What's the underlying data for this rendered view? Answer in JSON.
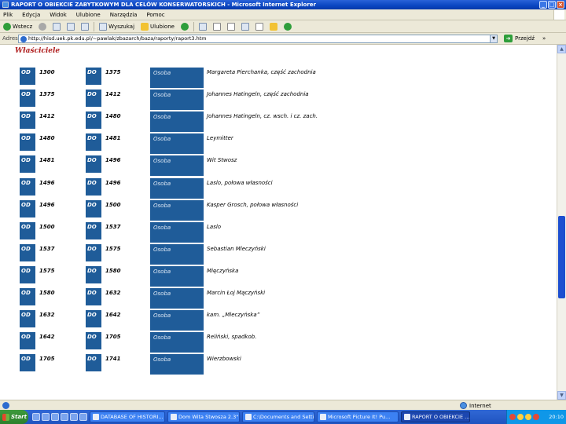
{
  "window": {
    "title": "RAPORT O OBIEKCIE ZABYTKOWYM DLA CELÓW KONSERWATORSKICH - Microsoft Internet Explorer"
  },
  "menu": [
    "Plik",
    "Edycja",
    "Widok",
    "Ulubione",
    "Narzędzia",
    "Pomoc"
  ],
  "toolbar": {
    "back_label": "Wstecz",
    "search_label": "Wyszukaj",
    "favorites_label": "Ulubione"
  },
  "address": {
    "label": "Adres",
    "url": "http://hisd.uek.pk.edu.pl/~pawlak/zbazarch/baza/raporty/raport3.htm",
    "go_label": "Przejdź",
    "links_label": "»"
  },
  "section": {
    "heading": "Właściciele"
  },
  "labels": {
    "od": "OD",
    "do": "DO",
    "osoba": "Osoba"
  },
  "owners": [
    {
      "from": "1300",
      "to": "1375",
      "name": "Margareta Pierchanka, część zachodnia"
    },
    {
      "from": "1375",
      "to": "1412",
      "name": "Johannes Hatingeln, część zachodnia"
    },
    {
      "from": "1412",
      "to": "1480",
      "name": "Johannes Hatingeln, cz. wsch. i cz. zach."
    },
    {
      "from": "1480",
      "to": "1481",
      "name": "Leymitter"
    },
    {
      "from": "1481",
      "to": "1496",
      "name": "Wit Stwosz"
    },
    {
      "from": "1496",
      "to": "1496",
      "name": "Laslo, połowa własności"
    },
    {
      "from": "1496",
      "to": "1500",
      "name": "Kasper Grosch, połowa własności"
    },
    {
      "from": "1500",
      "to": "1537",
      "name": "Laslo"
    },
    {
      "from": "1537",
      "to": "1575",
      "name": "Sebastian Mleczyński"
    },
    {
      "from": "1575",
      "to": "1580",
      "name": "Mięczyńska"
    },
    {
      "from": "1580",
      "to": "1632",
      "name": "Marcin Łoj Mączyński"
    },
    {
      "from": "1632",
      "to": "1642",
      "name": "kam. „Mleczyńska”"
    },
    {
      "from": "1642",
      "to": "1705",
      "name": "Reliński, spadkob."
    },
    {
      "from": "1705",
      "to": "1741",
      "name": "Wierzbowski"
    }
  ],
  "status": {
    "zone": "Internet"
  },
  "taskbar": {
    "start_label": "Start",
    "tasks": [
      {
        "label": "DATABASE OF HISTORI..."
      },
      {
        "label": "Dom Wita Stwosza 2.3\"..."
      },
      {
        "label": "C:\\Documents and Setti..."
      },
      {
        "label": "Microsoft Picture It! Pu..."
      },
      {
        "label": "RAPORT O OBIEKCIE ..."
      }
    ],
    "clock": "20:10"
  }
}
